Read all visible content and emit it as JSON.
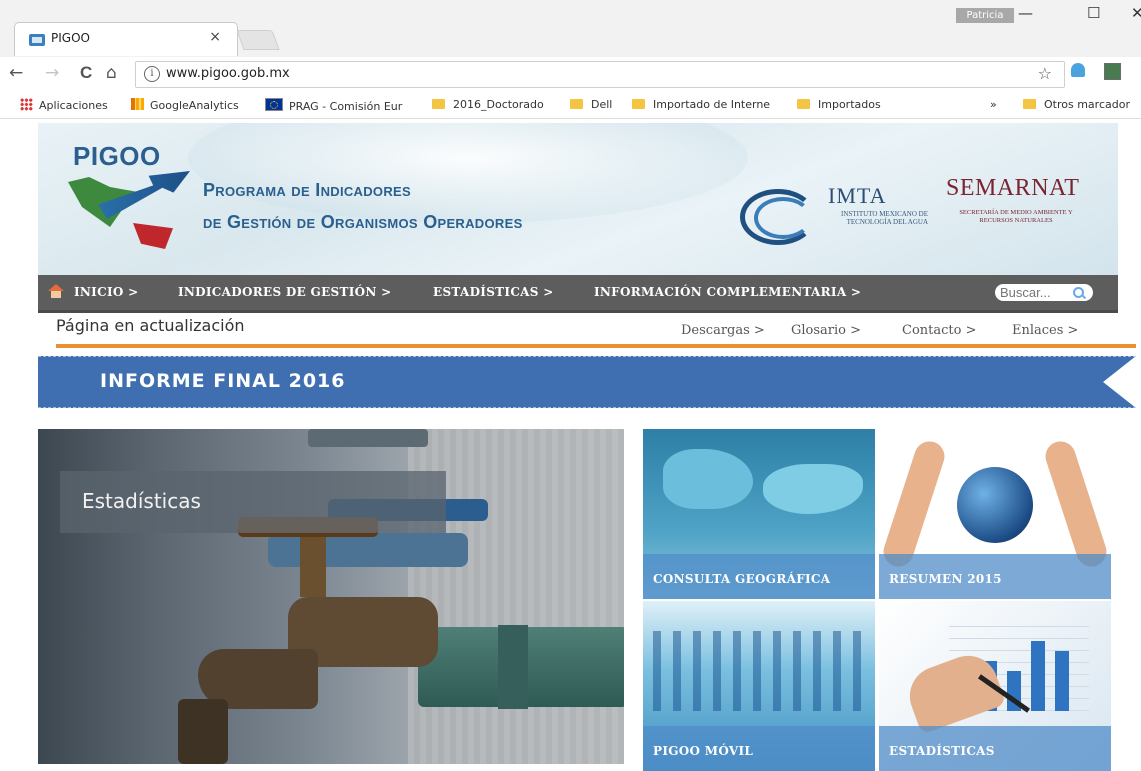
{
  "browser": {
    "tab_title": "PIGOO",
    "tab_close": "×",
    "user_badge": "Patricia",
    "win_min": "—",
    "win_max": "☐",
    "win_close": "✕",
    "url": "www.pigoo.gob.mx",
    "info_glyph": "i",
    "back_glyph": "←",
    "forward_glyph": "→",
    "reload_glyph": "C",
    "home_glyph": "⌂",
    "star_glyph": "☆",
    "bookmarks": [
      {
        "label": "Aplicaciones",
        "icon": "apps-icon"
      },
      {
        "label": "GoogleAnalytics",
        "icon": "analytics-icon"
      },
      {
        "label": "PRAG - Comisión Eur",
        "icon": "eu-flag-icon"
      },
      {
        "label": "2016_Doctorado",
        "icon": "folder-icon"
      },
      {
        "label": "Dell",
        "icon": "folder-icon"
      },
      {
        "label": "Importado de Interne",
        "icon": "folder-icon"
      },
      {
        "label": "Importados",
        "icon": "folder-icon"
      }
    ],
    "overflow": "»",
    "other_bookmarks": "Otros marcador"
  },
  "header": {
    "logo_text": "PIGOO",
    "program_line1": "Programa de Indicadores",
    "program_line2": "de Gestión de Organismos Operadores",
    "imta": "IMTA",
    "imta_sub": "INSTITUTO MEXICANO DE TECNOLOGÍA DEL AGUA",
    "semarnat": "SEMARNAT",
    "semarnat_sub": "SECRETARÍA DE MEDIO AMBIENTE Y RECURSOS NATURALES"
  },
  "nav": {
    "items": [
      "INICIO >",
      "INDICADORES DE GESTIÓN >",
      "ESTADÍSTICAS >",
      "INFORMACIÓN COMPLEMENTARIA >"
    ],
    "search_placeholder": "Buscar..."
  },
  "status_text": "Página en actualización",
  "subnav": [
    "Descargas >",
    "Glosario >",
    "Contacto >",
    "Enlaces >"
  ],
  "banner_title": "INFORME FINAL 2016",
  "hero_label": "Estadísticas",
  "tiles": {
    "geo": "CONSULTA GEOGRÁFICA",
    "resumen": "RESUMEN 2015",
    "movil": "PIGOO MÓVIL",
    "estadisticas": "ESTADÍSTICAS"
  },
  "colors": {
    "nav_bg": "#5d5d5d",
    "banner_bg": "#3f6fb1",
    "accent_orange": "#e7922e",
    "brand_blue": "#2a5f8f",
    "semarnat_red": "#7a2431"
  }
}
